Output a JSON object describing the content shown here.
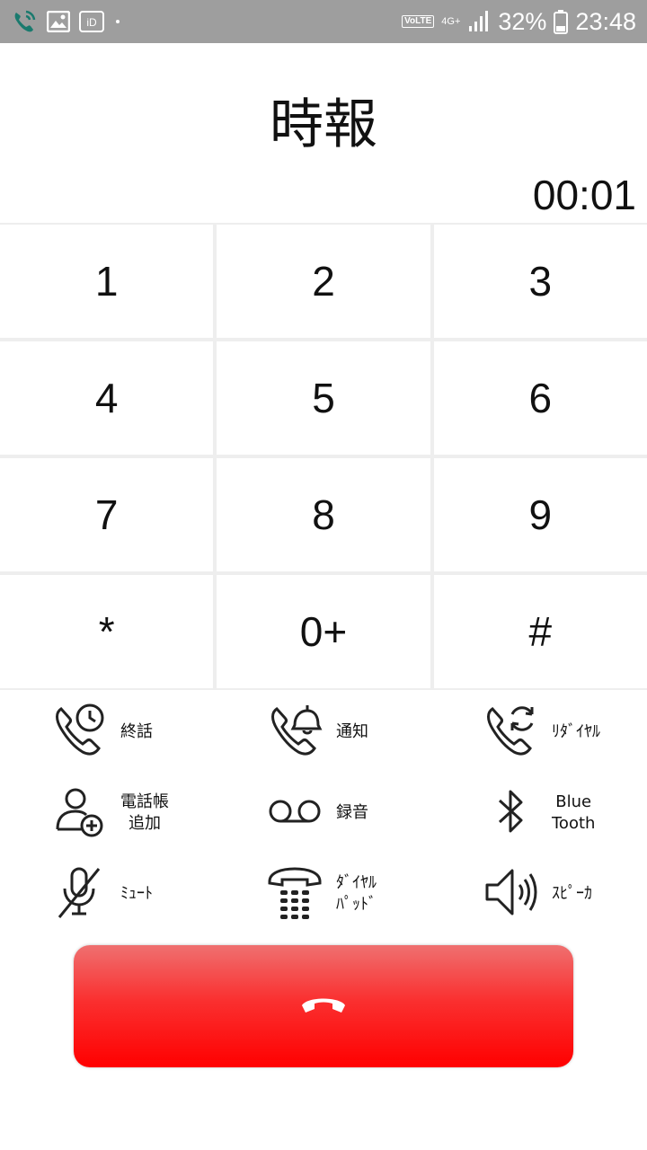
{
  "status_bar": {
    "volte": "VoLTE",
    "network": "4G+",
    "battery_percent": "32%",
    "time": "23:48",
    "icons": [
      "call-icon",
      "image-icon",
      "id-icon",
      "dot-icon",
      "signal-icon",
      "battery-icon"
    ]
  },
  "call": {
    "title": "時報",
    "timer": "00:01"
  },
  "keypad": {
    "keys": [
      "1",
      "2",
      "3",
      "4",
      "5",
      "6",
      "7",
      "8",
      "9",
      "*",
      "0+",
      "#"
    ]
  },
  "functions": {
    "end_call": "終話",
    "notify": "通知",
    "redial": "ﾘﾀﾞｲﾔﾙ",
    "add_contact_line1": "電話帳",
    "add_contact_line2": "追加",
    "record": "録音",
    "bluetooth_line1": "Blue",
    "bluetooth_line2": "Tooth",
    "mute": "ﾐｭｰﾄ",
    "dialpad_line1": "ﾀﾞｲﾔﾙ",
    "dialpad_line2": "ﾊﾟｯﾄﾞ",
    "speaker": "ｽﾋﾟｰｶ"
  },
  "colors": {
    "hangup_top": "#ef7070",
    "hangup_bottom": "#ff0000",
    "status_bar": "#9e9e9e"
  }
}
